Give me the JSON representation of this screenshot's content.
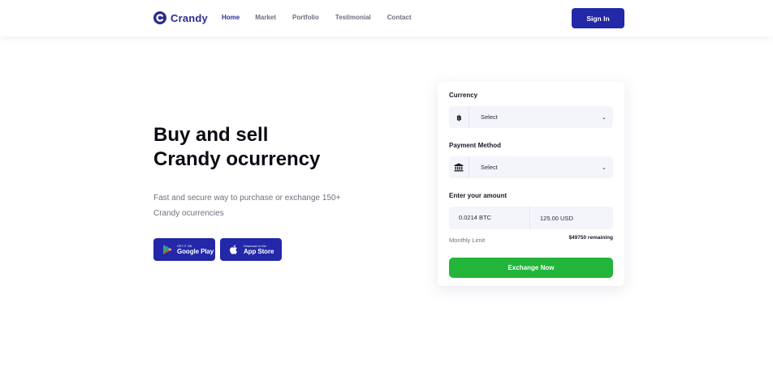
{
  "brand": {
    "name": "Crandy",
    "color": "#2b2c8f",
    "icon": "crandy-logo-icon"
  },
  "nav": {
    "items": [
      "Home",
      "Market",
      "Portfolio",
      "Testimonial",
      "Contact"
    ],
    "active": "Home"
  },
  "header": {
    "signin_label": "Sign In"
  },
  "hero": {
    "title_line1": "Buy and sell",
    "title_line2": "Crandy ocurrency",
    "subtitle": "Fast and secure way to purchase or exchange 150+ Crandy ocurrencies",
    "google_play": {
      "small": "GET IT ON",
      "big": "Google Play",
      "icon": "google-play-icon"
    },
    "app_store": {
      "small": "Download on the",
      "big": "App Store",
      "icon": "apple-icon"
    }
  },
  "exchange": {
    "currency_label": "Currency",
    "currency_value": "Select",
    "currency_icon": "bitcoin-icon",
    "payment_label": "Payment Method",
    "payment_value": "Select",
    "payment_icon": "bank-icon",
    "amount_label": "Enter your amount",
    "amount_btc": "0.0214 BTC",
    "amount_usd": "125.00 USD",
    "limit_label": "Monthly Limit",
    "limit_value": "$49750 remaining",
    "button_label": "Exchange Now"
  },
  "colors": {
    "primary": "#2228a8",
    "success": "#22b53a",
    "field_bg": "#f4f5fb"
  }
}
